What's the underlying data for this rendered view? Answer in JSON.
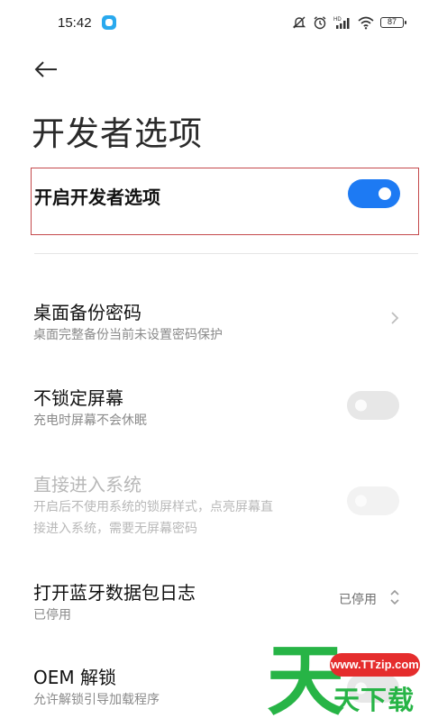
{
  "status_bar": {
    "time": "15:42",
    "battery": "87",
    "icons": [
      "app-badge-icon",
      "mute-icon",
      "alarm-icon",
      "hd-signal-icon",
      "wifi-icon",
      "battery-icon"
    ]
  },
  "header": {
    "title": "开发者选项",
    "back_icon": "back-arrow-icon"
  },
  "master": {
    "label": "开启开发者选项",
    "enabled": true,
    "accent": "#1d7af3"
  },
  "settings": [
    {
      "title": "桌面备份密码",
      "subtitle": "桌面完整备份当前未设置密码保护"
    },
    {
      "title": "不锁定屏幕",
      "subtitle": "充电时屏幕不会休眠",
      "toggle": false
    },
    {
      "title": "直接进入系统",
      "subtitle_line1": "开启后不使用系统的锁屏样式，点亮屏幕直",
      "subtitle_line2": "接进入系统，需要无屏幕密码",
      "toggle": false,
      "disabled": true
    },
    {
      "title": "打开蓝牙数据包日志",
      "subtitle": "已停用",
      "value": "已停用"
    },
    {
      "title": "OEM 解锁",
      "subtitle": "允许解锁引导加载程序"
    }
  ],
  "watermark": {
    "big": "天",
    "url": "www.TTzip.com",
    "text": "天下载"
  }
}
